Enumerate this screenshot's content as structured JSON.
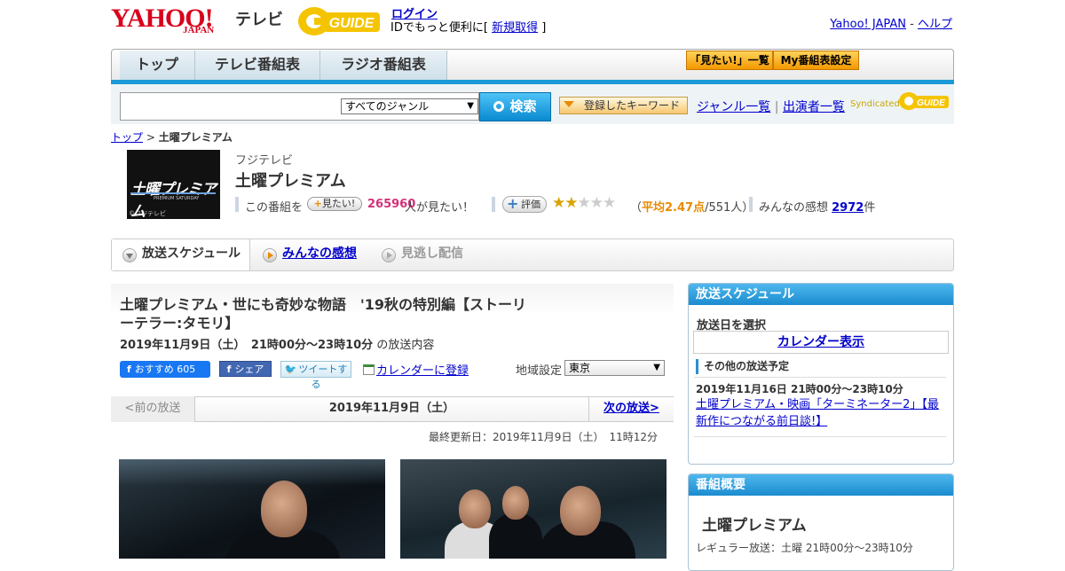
{
  "header": {
    "logo_yahoo": "YAHOO!",
    "logo_japan": "JAPAN",
    "logo_tv": "テレビ",
    "gguide_text": "GUIDE",
    "login": "ログイン",
    "login_sub_prefix": "IDでもっと便利に[ ",
    "register": "新規取得",
    "login_sub_suffix": " ]",
    "yj_link": "Yahoo! JAPAN",
    "yj_sep": " - ",
    "help_link": "ヘルプ"
  },
  "nav": {
    "tabs": [
      "トップ",
      "テレビ番組表",
      "ラジオ番組表"
    ],
    "mitai_list": "「見たい!」一覧",
    "my_schedule": "My番組表設定"
  },
  "search": {
    "placeholder": "",
    "genre": "すべてのジャンル",
    "button": "検索",
    "keyword_btn": "登録したキーワード",
    "genre_list": "ジャンル一覧",
    "sep": " | ",
    "performer_list": "出演者一覧",
    "syndicated": "Syndicated"
  },
  "breadcrumb": {
    "top": "トップ",
    "sep": " > ",
    "current": "土曜プレミアム"
  },
  "program": {
    "thumb_text": "土曜プレミアム",
    "thumb_sub": "PREMIUM SATURDAY",
    "thumb_credit": "©フジテレビ",
    "channel": "フジテレビ",
    "title": "土曜プレミアム",
    "want_prefix": "この番組を",
    "want_btn": "見たい!",
    "want_count": "265960",
    "want_suffix": "人が見たい！",
    "rate_btn": "評価",
    "stars_filled": "★★",
    "stars_empty": "★★★",
    "rate_prefix": "（",
    "rate_avg_label": "平均2.47点",
    "rate_suffix": "/551人）",
    "impressions_prefix": "みんなの感想 ",
    "impressions_count": "2972",
    "impressions_suffix": "件"
  },
  "tabs": {
    "schedule": "放送スケジュール",
    "reviews": "みんなの感想",
    "vod": "見逃し配信"
  },
  "episode": {
    "title": "土曜プレミアム・世にも奇妙な物語　'19秋の特別編【ストーリーテラー:タモリ】",
    "date": "2019年11月9日（土）　21時00分～23時10分",
    "date_suffix": " の放送内容",
    "fb_label": "おすすめ 605",
    "fb_share": "シェア",
    "tweet": "ツイートする",
    "calendar": "カレンダーに登録",
    "region_label": "地域設定",
    "region": "東京",
    "prev": "<前の放送",
    "current_date": "2019年11月9日（土）",
    "next": "次の放送>",
    "updated": "最終更新日：2019年11月9日（土）　11時12分"
  },
  "sidebar": {
    "schedule_head": "放送スケジュール",
    "select_date": "放送日を選択",
    "calendar_btn": "カレンダー表示",
    "other_head": "その他の放送予定",
    "other_date": "2019年11月16日  21時00分～23時10分",
    "other_title": "土曜プレミアム・映画「ターミネーター2」【最新作につながる前日談!】",
    "overview_head": "番組概要",
    "overview_title": "土曜プレミアム",
    "overview_regular": "レギュラー放送：土曜 21時00分～23時10分"
  },
  "colors": {
    "brand_red": "#d9001b",
    "accent_blue": "#1a9bd7",
    "orange": "#f39800",
    "want_pink": "#d3317a"
  }
}
